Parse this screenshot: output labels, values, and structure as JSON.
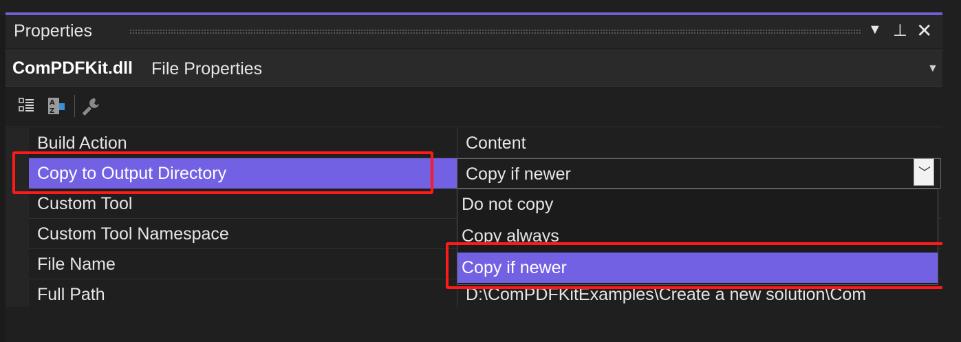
{
  "panel": {
    "title": "Properties",
    "icons": {
      "dropdown": "chevron-down-icon",
      "pin": "pin-icon",
      "close": "close-icon"
    }
  },
  "object_selector": {
    "name": "ComPDFKit.dll",
    "type": "File Properties"
  },
  "toolbar": {
    "buttons": [
      "categorized-icon",
      "alphabetical-icon",
      "property-pages-icon"
    ]
  },
  "properties": [
    {
      "name": "Build Action",
      "value": "Content"
    },
    {
      "name": "Copy to Output Directory",
      "value": "Copy if newer",
      "selected": true
    },
    {
      "name": "Custom Tool",
      "value": ""
    },
    {
      "name": "Custom Tool Namespace",
      "value": ""
    },
    {
      "name": "File Name",
      "value": ""
    },
    {
      "name": "Full Path",
      "value": "D:\\ComPDFKitExamples\\Create a new solution\\Com"
    }
  ],
  "dropdown": {
    "options": [
      "Do not copy",
      "Copy always",
      "Copy if newer"
    ],
    "highlighted": "Copy if newer"
  },
  "colors": {
    "accent": "#7361e4",
    "annotation_red": "#ff1a1a",
    "background": "#1f1f1f"
  }
}
